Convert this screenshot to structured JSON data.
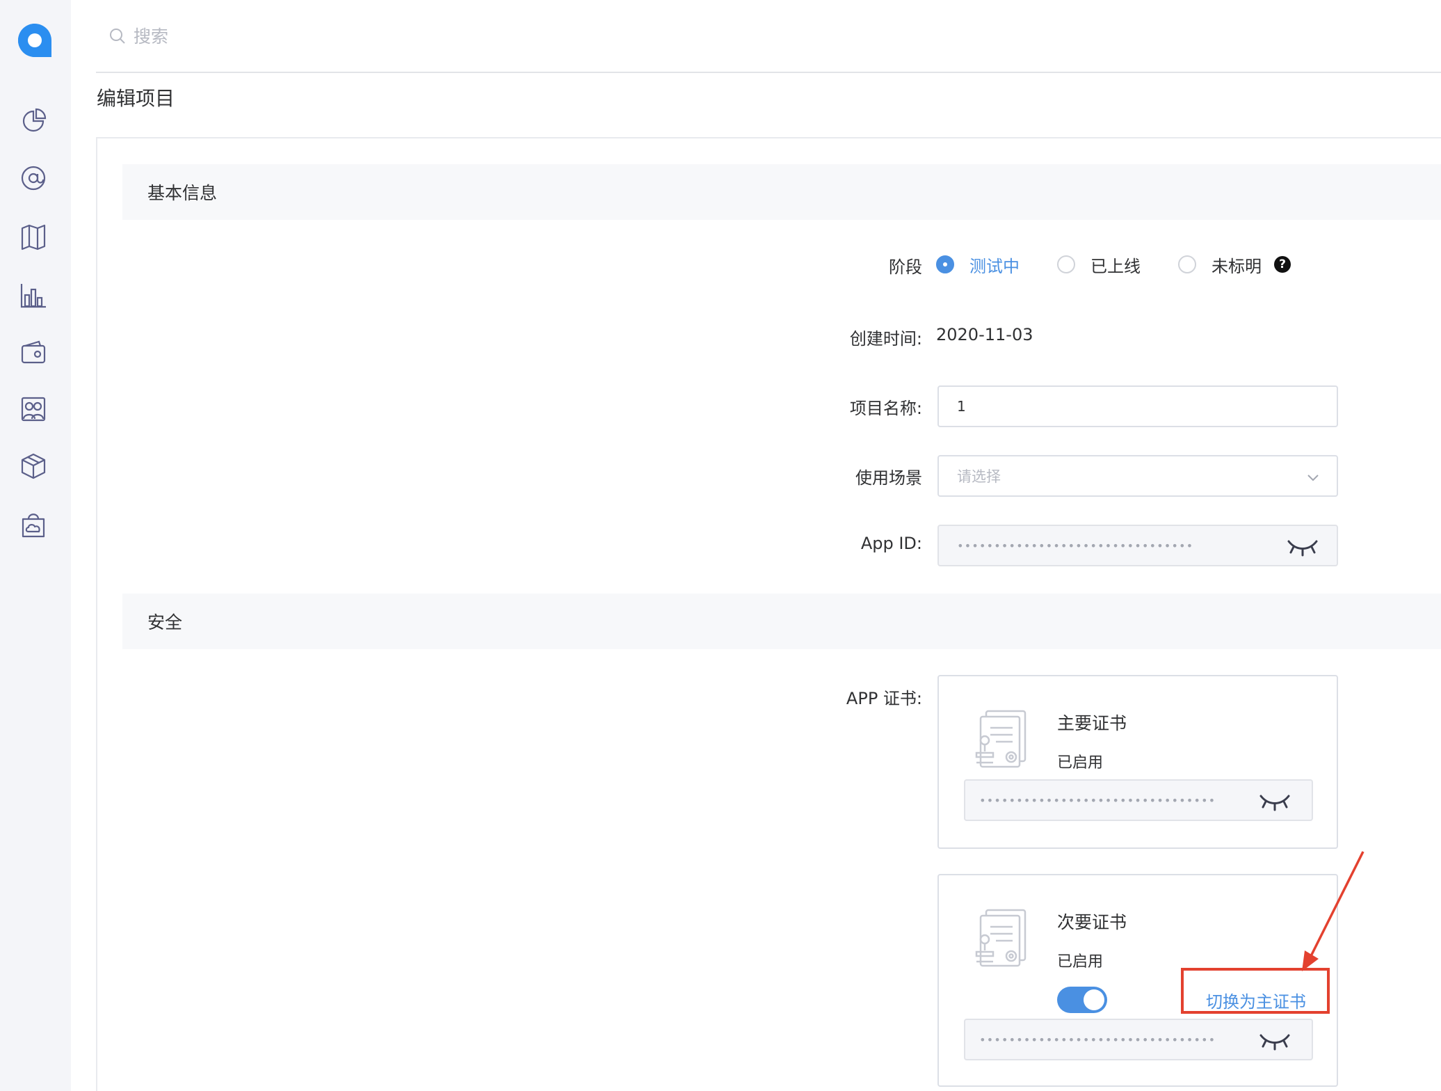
{
  "header": {
    "search_placeholder": "搜索"
  },
  "page": {
    "title": "编辑项目"
  },
  "sections": {
    "basic": "基本信息",
    "security": "安全"
  },
  "form": {
    "stage_label": "阶段",
    "stage_options": [
      "测试中",
      "已上线",
      "未标明"
    ],
    "stage_selected": "测试中",
    "created_label": "创建时间:",
    "created_value": "2020-11-03",
    "name_label": "项目名称:",
    "name_value": "1",
    "scene_label": "使用场景",
    "scene_placeholder": "请选择",
    "appid_label": "App ID:",
    "appid_masked": "••••••••••••••••••••••••••••••••",
    "cert_label": "APP 证书:"
  },
  "certificates": {
    "primary": {
      "title": "主要证书",
      "status": "已启用",
      "masked": "••••••••••••••••••••••••••••••••"
    },
    "secondary": {
      "title": "次要证书",
      "status": "已启用",
      "masked": "••••••••••••••••••••••••••••••••",
      "switch_label": "切换为主证书"
    }
  },
  "icons": {
    "sidebar": [
      "pie-chart-icon",
      "at-sign-icon",
      "map-icon",
      "bar-chart-icon",
      "wallet-icon",
      "users-icon",
      "box-icon",
      "cloud-bag-icon"
    ],
    "accent": "#4a90e2",
    "highlight": "#e3412f"
  }
}
